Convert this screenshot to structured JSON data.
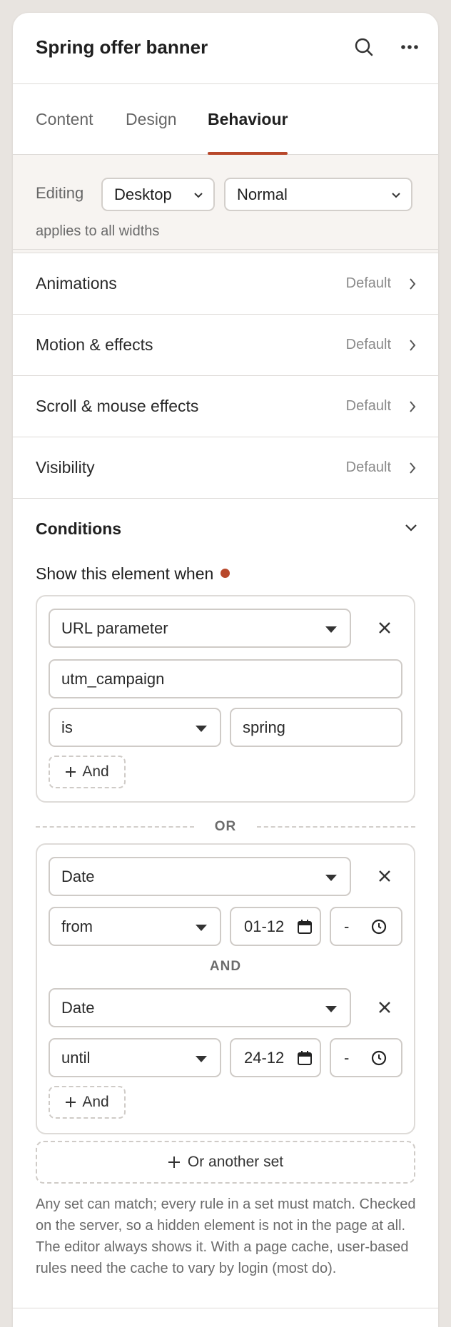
{
  "header": {
    "title": "Spring offer banner",
    "search_icon": "search-icon",
    "more_icon": "more-horizontal-icon"
  },
  "tabs": [
    {
      "label": "Content",
      "active": false
    },
    {
      "label": "Design",
      "active": false
    },
    {
      "label": "Behaviour",
      "active": true
    }
  ],
  "editing": {
    "label": "Editing",
    "device": "Desktop",
    "state": "Normal",
    "note": "applies to all widths"
  },
  "sections": [
    {
      "label": "Animations",
      "value": "Default"
    },
    {
      "label": "Motion & effects",
      "value": "Default"
    },
    {
      "label": "Scroll & mouse effects",
      "value": "Default"
    },
    {
      "label": "Visibility",
      "value": "Default"
    }
  ],
  "conditions": {
    "title": "Conditions",
    "show_when": "Show this element when",
    "set1": {
      "rule_type": "URL parameter",
      "param": "utm_campaign",
      "operator": "is",
      "value": "spring",
      "and_label": "And"
    },
    "or_label": "OR",
    "set2": {
      "rule1": {
        "type": "Date",
        "operator": "from",
        "date": "01-12",
        "time": "-"
      },
      "and_label_sep": "AND",
      "rule2": {
        "type": "Date",
        "operator": "until",
        "date": "24-12",
        "time": "-"
      },
      "and_label": "And"
    },
    "or_another_set": "Or another set",
    "help": "Any set can match; every rule in a set must match. Checked on the server, so a hidden element is not in the page at all. The editor always shows it. With a page cache, user-based rules need the cache to vary by login (most do)."
  },
  "colors": {
    "accent": "#b8482b",
    "panel_bg": "#ffffff",
    "page_bg": "#e8e4e0",
    "editing_bg": "#f7f4f1"
  }
}
